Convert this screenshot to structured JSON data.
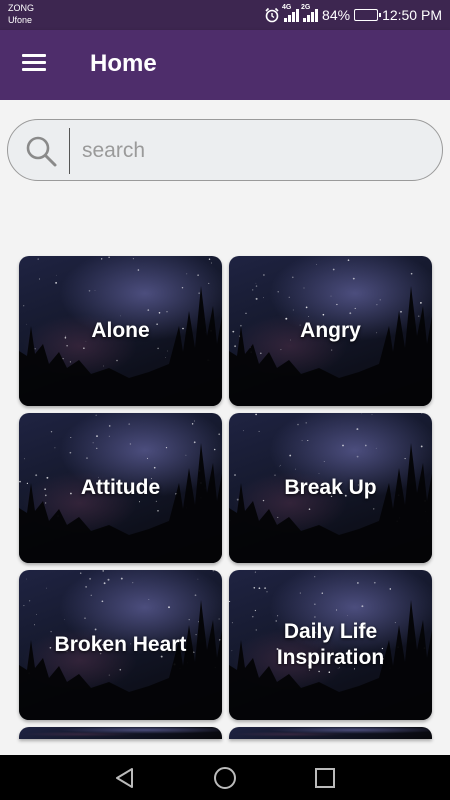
{
  "status_bar": {
    "carrier_1": "ZONG",
    "carrier_2": "Ufone",
    "network_1": "4G",
    "network_2": "2G",
    "battery_percent": "84%",
    "battery_level": 0.84,
    "time": "12:50 PM",
    "icons": [
      "alarm-icon",
      "signal-icon",
      "signal-icon",
      "battery-icon"
    ]
  },
  "app_bar": {
    "title": "Home",
    "menu_icon": "hamburger-menu-icon",
    "color": "#4e2d6b"
  },
  "search": {
    "placeholder": "search",
    "value": "",
    "icon": "search-icon"
  },
  "categories": [
    {
      "label": "Alone"
    },
    {
      "label": "Angry"
    },
    {
      "label": "Attitude"
    },
    {
      "label": "Break Up"
    },
    {
      "label": "Broken Heart"
    },
    {
      "label": "Daily Life\nInspiration"
    }
  ],
  "nav_bar": {
    "icons": [
      "back-triangle-icon",
      "home-circle-icon",
      "recents-square-icon"
    ]
  }
}
